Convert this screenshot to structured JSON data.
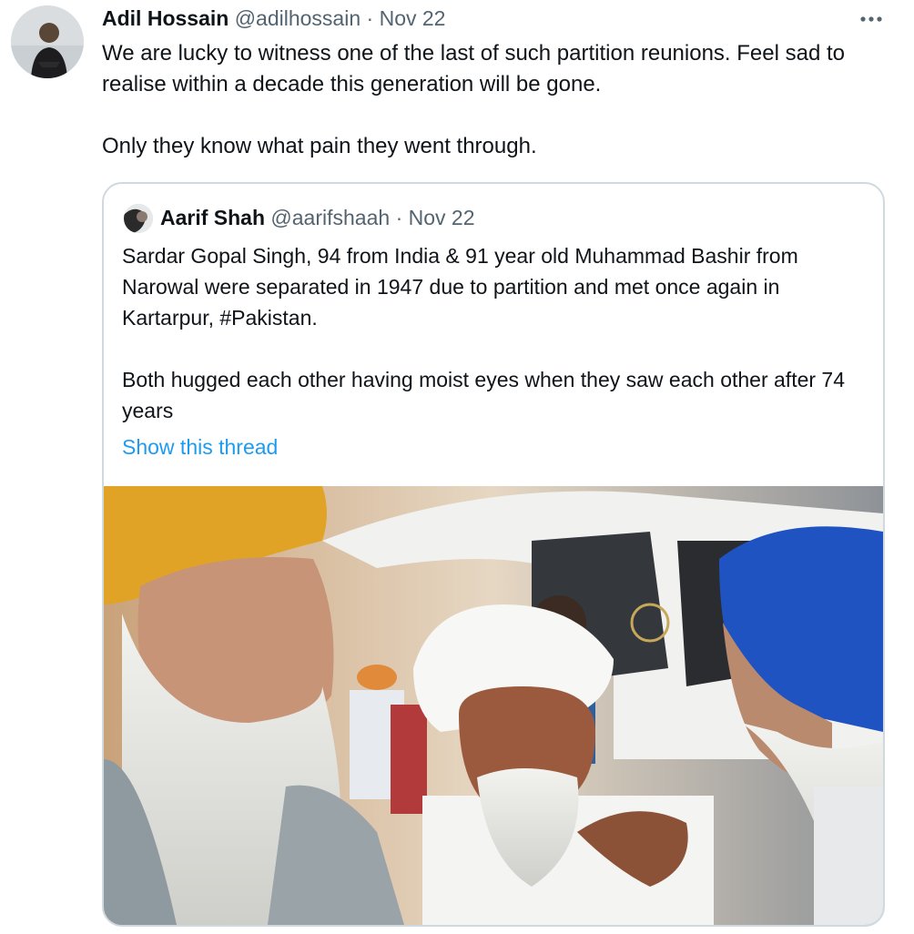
{
  "tweet": {
    "author_name": "Adil Hossain",
    "handle": "@adilhossain",
    "separator": "·",
    "date": "Nov 22",
    "text": "We are lucky to witness one of the last of such partition reunions. Feel sad to realise within a decade this generation will be gone.\n\nOnly they know what pain they went through.",
    "more_icon": "more-horizontal-icon"
  },
  "quote": {
    "author_name": "Aarif Shah",
    "handle": "@aarifshaah",
    "separator": "·",
    "date": "Nov 22",
    "text": "Sardar Gopal Singh, 94 from India & 91 year old Muhammad Bashir from Narowal were separated in 1947 due to partition and met once again in Kartarpur, #Pakistan.\n\nBoth hugged each other having moist eyes when they saw each other after 74 years",
    "show_thread": "Show this thread"
  },
  "colors": {
    "text_primary": "#0f1419",
    "text_secondary": "#536471",
    "link": "#1d9bf0",
    "border": "#cfd9de"
  }
}
